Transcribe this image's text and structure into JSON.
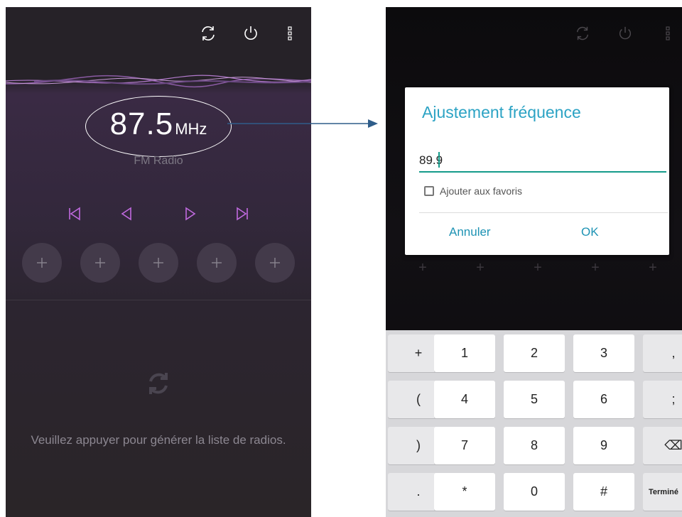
{
  "left_screen": {
    "toolbar": {
      "refresh_icon": "refresh-icon",
      "power_icon": "power-icon",
      "more_icon": "more-vert-icon"
    },
    "frequency": {
      "value": "87.5",
      "unit": "MHz"
    },
    "source_label": "FM Radio",
    "controls": [
      "skip-previous-icon",
      "seek-back-icon",
      "seek-forward-icon",
      "skip-next-icon"
    ],
    "presets": [
      "+",
      "+",
      "+",
      "+",
      "+"
    ],
    "hint": "Veuillez appuyer pour générer la liste de radios.",
    "accent_color": "#c06adf"
  },
  "right_screen": {
    "dialog": {
      "title": "Ajustement fréquence",
      "input_value": "89.9",
      "checkbox_label": "Ajouter aux favoris",
      "checkbox_checked": false,
      "cancel_label": "Annuler",
      "ok_label": "OK"
    },
    "dim_presets": [
      "+",
      "+",
      "+",
      "+",
      "+"
    ],
    "keyboard": {
      "rows": [
        [
          "+",
          "1",
          "2",
          "3",
          ","
        ],
        [
          "(",
          "4",
          "5",
          "6",
          ";"
        ],
        [
          ")",
          "7",
          "8",
          "9",
          "⌫"
        ],
        [
          ".",
          "*",
          "0",
          "#",
          "Terminé"
        ]
      ],
      "row_hints": [
        "",
        "",
        "-",
        "/"
      ]
    },
    "accent_color": "#2ca3c4"
  }
}
